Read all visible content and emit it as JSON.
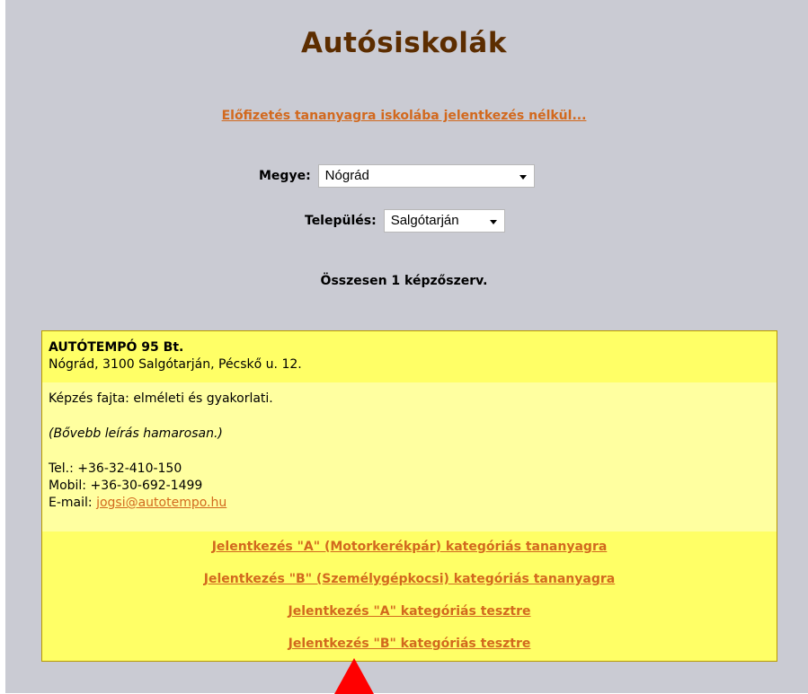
{
  "page": {
    "title": "Autósiskolák",
    "subscribe_link": "Előfizetés tananyagra iskolába jelentkezés nélkül..."
  },
  "filters": {
    "county_label": "Megye:",
    "county_value": "Nógrád",
    "town_label": "Település:",
    "town_value": "Salgótarján"
  },
  "summary": {
    "count_text": "Összesen 1 képzőszerv."
  },
  "school": {
    "name": "AUTÓTEMPÓ 95 Bt.",
    "address": "Nógrád, 3100 Salgótarján, Pécskő u. 12.",
    "training_type": "Képzés fajta: elméleti és gyakorlati.",
    "note": "(Bővebb leírás hamarosan.)",
    "phone": "Tel.: +36-32-410-150",
    "mobile": "Mobil: +36-30-692-1499",
    "email_label": "E-mail: ",
    "email": "jogsi@autotempo.hu",
    "links": [
      "Jelentkezés \"A\" (Motorkerékpár) kategóriás tananyagra",
      "Jelentkezés \"B\" (Személygépkocsi) kategóriás tananyagra",
      "Jelentkezés \"A\" kategóriás tesztre",
      "Jelentkezés \"B\" kategóriás tesztre"
    ]
  },
  "colors": {
    "background": "#cacbd3",
    "title": "#5c2d00",
    "link": "#d2691e",
    "card_head": "#ffff66",
    "card_body": "#ffffa0",
    "pointer": "#ff0000"
  },
  "icons": {
    "select_arrow": "chevron-down-icon",
    "pointer": "red-triangle-pointer"
  }
}
